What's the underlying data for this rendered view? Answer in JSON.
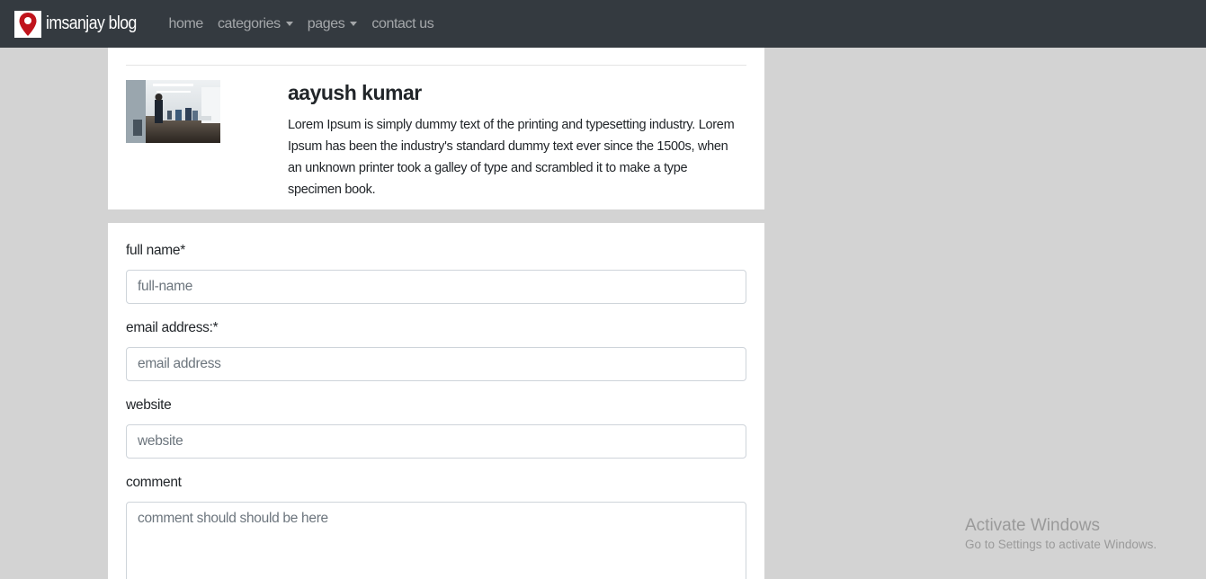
{
  "navbar": {
    "brand": "imsanjay blog",
    "items": [
      {
        "label": "home",
        "dropdown": false
      },
      {
        "label": "categories",
        "dropdown": true
      },
      {
        "label": "pages",
        "dropdown": true
      },
      {
        "label": "contact us",
        "dropdown": false
      }
    ]
  },
  "author": {
    "name": "aayush kumar",
    "bio": "Lorem Ipsum is simply dummy text of the printing and typesetting industry. Lorem Ipsum has been the industry's standard dummy text ever since the 1500s, when an unknown printer took a galley of type and scrambled it to make a type specimen book."
  },
  "form": {
    "full_name": {
      "label": "full name*",
      "placeholder": "full-name"
    },
    "email": {
      "label": "email address:*",
      "placeholder": "email address"
    },
    "website": {
      "label": "website",
      "placeholder": "website"
    },
    "comment": {
      "label": "comment",
      "placeholder": "comment should should be here"
    }
  },
  "watermark": {
    "title": "Activate Windows",
    "subtitle": "Go to Settings to activate Windows."
  },
  "colors": {
    "navbar_bg": "#343a40",
    "page_bg": "#d3d3d3",
    "logo_pin": "#c0141c"
  }
}
